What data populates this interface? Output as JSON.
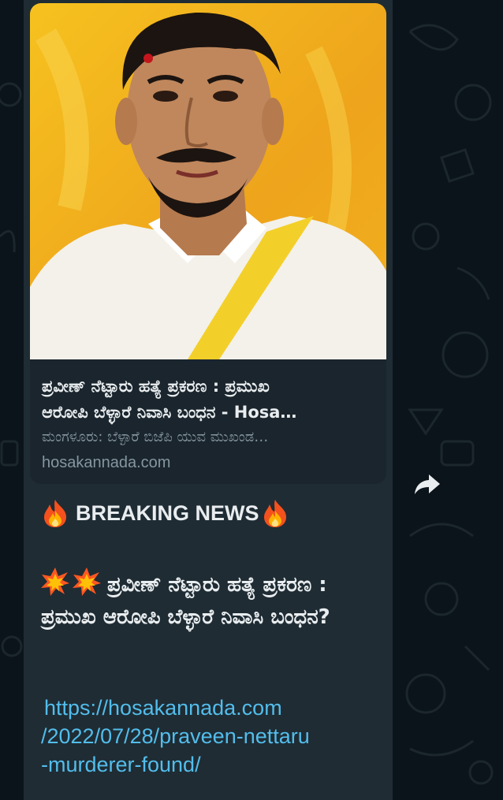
{
  "link_preview": {
    "title_line1": "ಪ್ರವೀಣ್ ನೆಟ್ಟಾರು ಹತ್ಯೆ ಪ್ರಕರಣ : ಪ್ರಮುಖ",
    "title_line2": "ಆರೋಪಿ ಬೆಳ್ಳಾರೆ ನಿವಾಸಿ ಬಂಧನ - Hosa…",
    "description": "ಮಂಗಳೂರು: ಬೆಳ್ಳಾರೆ ಬಿಜೆಪಿ ಯುವ ಮುಖಂಡ…",
    "domain": "hosakannada.com"
  },
  "message": {
    "breaking_label": "BREAKING NEWS",
    "headline": "ಪ್ರವೀಣ್ ನೆಟ್ಟಾರು ಹತ್ಯೆ ಪ್ರಕರಣ : ಪ್ರಮುಖ ಆರೋಪಿ ಬೆಳ್ಳಾರೆ ನಿವಾಸಿ ಬಂಧನ?",
    "link_line1": "https://hosakannada.com",
    "link_line2": "/2022/07/28/praveen-nettaru",
    "link_line3": "-murderer-found/"
  },
  "icons": {
    "fire": "fire-emoji",
    "collision": "collision-emoji",
    "share": "forward-arrow-icon"
  },
  "colors": {
    "background": "#0b141a",
    "bubble": "#1f2c34",
    "preview_card": "#1a252d",
    "primary_text": "#e9edef",
    "secondary_text": "#8696a0",
    "link": "#53bdeb",
    "photo_background": "#f2b01e"
  }
}
